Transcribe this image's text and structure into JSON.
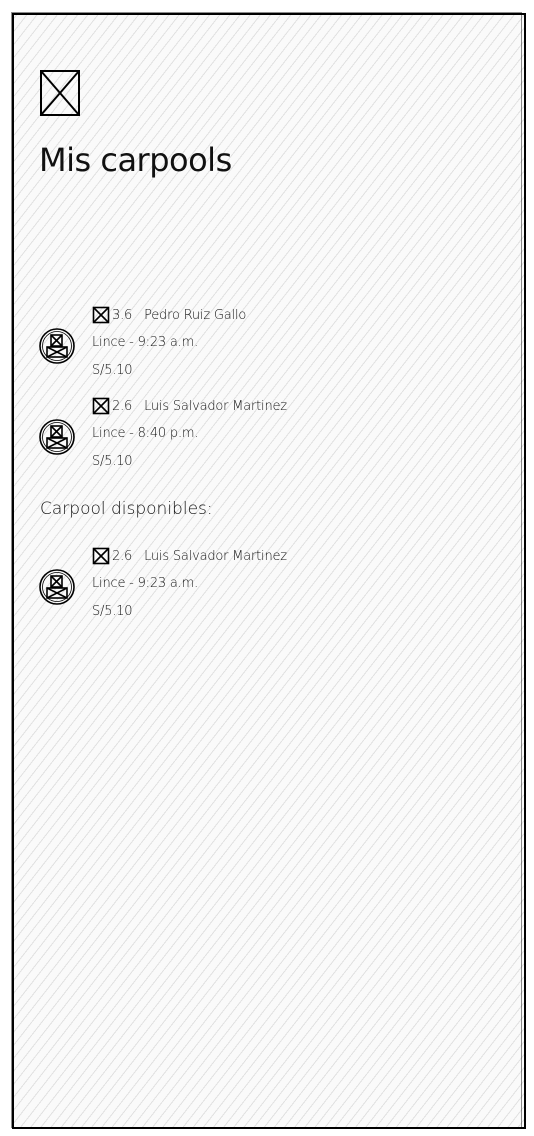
{
  "header": {
    "back_icon": "placeholder-image-icon",
    "title": "Mis carpools"
  },
  "my_carpools": [
    {
      "rating": "3.6",
      "driver": "Pedro Ruiz Gallo",
      "route": "Lince - 9:23 a.m.",
      "price": "S/5.10"
    },
    {
      "rating": "2.6",
      "driver": "Luis Salvador Martinez",
      "route": "Lince - 8:40 p.m.",
      "price": "S/5.10"
    }
  ],
  "available_section": {
    "label": "Carpool disponibles:",
    "items": [
      {
        "rating": "2.6",
        "driver": "Luis Salvador Martinez",
        "route": "Lince - 9:23 a.m.",
        "price": "S/5.10"
      }
    ]
  },
  "icons": {
    "rating": "placeholder-image-icon",
    "avatar": "user-avatar-icon"
  },
  "colors": {
    "ink": "#111111",
    "background": "#fafafa"
  }
}
